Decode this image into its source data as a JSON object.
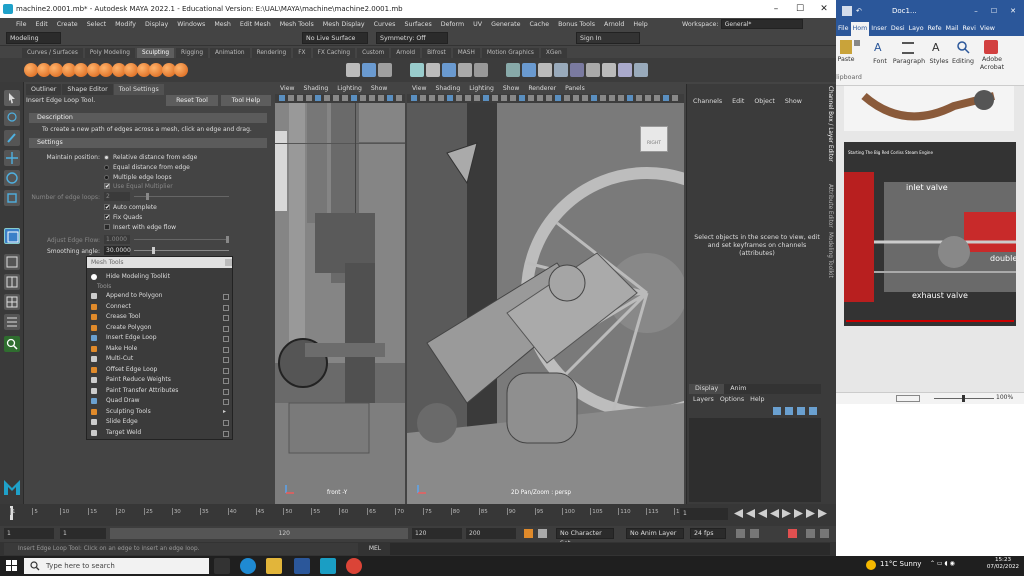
{
  "maya": {
    "title": "machine2.0001.mb* - Autodesk MAYA 2022.1 - Educational Version: E:\\UAL\\MAYA\\machine\\machine2.0001.mb",
    "menus": [
      "File",
      "Edit",
      "Create",
      "Select",
      "Modify",
      "Display",
      "Windows",
      "Mesh",
      "Edit Mesh",
      "Mesh Tools",
      "Mesh Display",
      "Curves",
      "Surfaces",
      "Deform",
      "UV",
      "Generate",
      "Cache",
      "Bonus Tools",
      "Arnold",
      "Help"
    ],
    "workspace_label": "Workspace:",
    "workspace_value": "General*",
    "menuset": "Modeling",
    "live_surface": "No Live Surface",
    "symmetry": "Symmetry: Off",
    "sign_in": "Sign In",
    "shelf_tabs": [
      "Curves / Surfaces",
      "Poly Modeling",
      "Sculpting",
      "Rigging",
      "Animation",
      "Rendering",
      "FX",
      "FX Caching",
      "Custom",
      "Arnold",
      "Bifrost",
      "MASH",
      "Motion Graphics",
      "XGen"
    ],
    "shelf_active": "Sculpting"
  },
  "tool_panel": {
    "tabs": [
      "Outliner",
      "Shape Editor",
      "Tool Settings"
    ],
    "tool_name": "Insert Edge Loop Tool",
    "reset_label": "Reset Tool",
    "help_label": "Tool Help",
    "description_header": "Description",
    "description_text": "To create a new path of edges across a mesh, click an edge and drag.",
    "settings_header": "Settings",
    "maintain_label": "Maintain position:",
    "radio_options": [
      "Relative distance from edge",
      "Equal distance from edge",
      "Multiple edge loops"
    ],
    "use_equal_multiplier": "Use Equal Multiplier",
    "num_loops_label": "Number of edge loops:",
    "num_loops_value": "2",
    "checkboxes": [
      "Auto complete",
      "Fix Quads",
      "Insert with edge flow"
    ],
    "adjust_flow_label": "Adjust Edge Flow:",
    "adjust_flow_value": "1.0000",
    "smoothing_label": "Smoothing angle:",
    "smoothing_value": "30.0000"
  },
  "mesh_menu": {
    "header": "Mesh Tools",
    "hide_toolkit": "Hide Modeling Toolkit",
    "section": "Tools",
    "items": [
      "Append to Polygon",
      "Connect",
      "Crease Tool",
      "Create Polygon",
      "Insert Edge Loop",
      "Make Hole",
      "Multi-Cut",
      "Offset Edge Loop",
      "Paint Reduce Weights",
      "Paint Transfer Attributes",
      "Quad Draw",
      "Sculpting Tools",
      "Slide Edge",
      "Target Weld"
    ]
  },
  "viewports": {
    "menu": [
      "View",
      "Shading",
      "Lighting",
      "Show"
    ],
    "menu2": [
      "View",
      "Shading",
      "Lighting",
      "Show",
      "Renderer",
      "Panels"
    ],
    "vp1_label": "front -Y",
    "vp2_label": "2D Pan/Zoom : persp",
    "cube_label": "RIGHT"
  },
  "channel_box": {
    "menu": [
      "Channels",
      "Edit",
      "Object",
      "Show"
    ],
    "message": "Select objects in the scene to view, edit and set keyframes on channels (attributes)",
    "layer_tabs": [
      "Display",
      "Anim"
    ],
    "layer_menu": [
      "Layers",
      "Options",
      "Help"
    ],
    "side_tabs": [
      "Channel Box / Layer Editor",
      "Attribute Editor",
      "Modeling Toolkit"
    ]
  },
  "timeline": {
    "ticks": [
      "1",
      "5",
      "10",
      "15",
      "20",
      "25",
      "30",
      "35",
      "40",
      "45",
      "50",
      "55",
      "60",
      "65",
      "70",
      "75",
      "80",
      "85",
      "90",
      "95",
      "100",
      "105",
      "110",
      "115",
      "120"
    ],
    "current_frame": "1",
    "range_start": "1",
    "range_start2": "1",
    "range_end_marker": "120",
    "range_end": "120",
    "anim_end": "200",
    "character_set": "No Character Set",
    "anim_layer": "No Anim Layer",
    "fps": "24 fps",
    "mel": "MEL",
    "help_line": "Insert Edge Loop Tool: Click on an edge to insert an edge loop."
  },
  "word": {
    "title": "Doc1...",
    "tabs": [
      "File",
      "Hom",
      "Inser",
      "Desi",
      "Layo",
      "Refe",
      "Mail",
      "Revi",
      "View"
    ],
    "active_tab": "Hom",
    "groups": [
      "Paste",
      "Font",
      "Paragraph",
      "Styles",
      "Editing",
      "Adobe Acrobat"
    ],
    "clipboard": "lipboard",
    "video_labels": [
      "inlet valve",
      "double",
      "exhaust valve"
    ],
    "video_title": "Starting The Big Red Corliss Steam Engine",
    "zoom": "100%"
  },
  "taskbar": {
    "search_placeholder": "Type here to search",
    "weather": "11°C  Sunny",
    "time": "15:23",
    "date": "07/02/2022"
  }
}
